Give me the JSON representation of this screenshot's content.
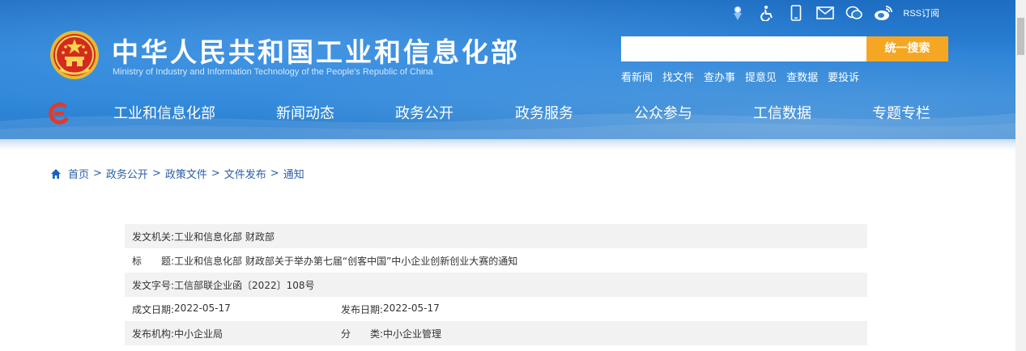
{
  "header": {
    "title_cn": "中华人民共和国工业和信息化部",
    "title_en": "Ministry of Industry and Information Technology of the People's Republic of China",
    "top_icons": [
      "accessibility-badge-icon",
      "wheelchair-icon",
      "mobile-phone-icon",
      "mail-icon",
      "wechat-icon",
      "weibo-icon"
    ],
    "rss_label": "RSS订阅",
    "search": {
      "value": "",
      "button_label": "统一搜索"
    },
    "quick_links": [
      "看新闻",
      "找文件",
      "查办事",
      "提意见",
      "查数据",
      "要投诉"
    ],
    "nav": [
      "工业和信息化部",
      "新闻动态",
      "政务公开",
      "政务服务",
      "公众参与",
      "工信数据",
      "专题专栏"
    ],
    "colors": {
      "header_blue": "#2a82d6",
      "search_button": "#f5a623"
    }
  },
  "breadcrumb": [
    "首页",
    "政务公开",
    "政策文件",
    "文件发布",
    "通知"
  ],
  "breadcrumb_sep": ">",
  "meta": {
    "issuer_label": "发文机关:",
    "issuer": "工业和信息化部 财政部",
    "title_label": "标　　题:",
    "title": "工业和信息化部 财政部关于举办第七届“创客中国”中小企业创新创业大赛的通知",
    "doc_no_label": "发文字号:",
    "doc_no": "工信部联企业函〔2022〕108号",
    "written_date_label": "成文日期:",
    "written_date": "2022-05-17",
    "publish_date_label": "发布日期:",
    "publish_date": "2022-05-17",
    "publisher_label": "发布机构:",
    "publisher": "中小企业局",
    "category_label": "分　　类:",
    "category": "中小企业管理"
  }
}
